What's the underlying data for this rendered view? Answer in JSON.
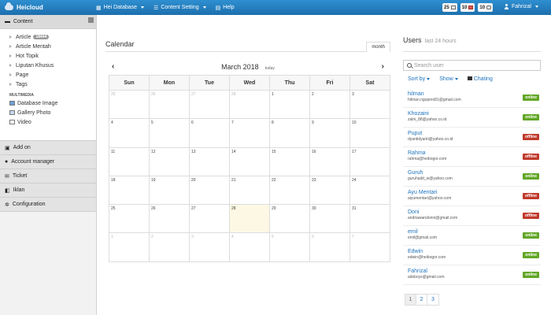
{
  "app": {
    "brand": "Heicloud"
  },
  "topnav": [
    {
      "label": "Hei Database",
      "icon": "grid-icon"
    },
    {
      "label": "Content Setting",
      "icon": "list-icon"
    },
    {
      "label": "Help",
      "icon": "help-icon"
    }
  ],
  "badges": [
    {
      "count": "25",
      "icon": "keyboard-icon"
    },
    {
      "count": "10",
      "icon": "calendar-icon"
    },
    {
      "count": "10",
      "icon": "chat-icon"
    }
  ],
  "user_menu": {
    "name": "Fahrizal"
  },
  "sidebar": {
    "content_title": "Content",
    "items": [
      {
        "label": "Article",
        "count": "18444"
      },
      {
        "label": "Article Mentah"
      },
      {
        "label": "Hot Topik"
      },
      {
        "label": "Liputan Khusus"
      },
      {
        "label": "Page"
      },
      {
        "label": "Tags"
      }
    ],
    "multimedia_title": "MULTIMEDIA",
    "media": [
      {
        "label": "Database Image"
      },
      {
        "label": "Gallery Photo"
      },
      {
        "label": "Video"
      }
    ],
    "sections": [
      {
        "label": "Add on"
      },
      {
        "label": "Account manager"
      },
      {
        "label": "Ticket"
      },
      {
        "label": "Iklan"
      },
      {
        "label": "Configuration"
      }
    ]
  },
  "calendar": {
    "title": "Calendar",
    "tab": "month",
    "month_label": "March 2018",
    "today_label": "today",
    "prev": "‹",
    "next": "›",
    "days": [
      "Sun",
      "Mon",
      "Tue",
      "Wed",
      "Thu",
      "Fri",
      "Sat"
    ],
    "weeks": [
      [
        "25",
        "26",
        "27",
        "28",
        "1",
        "2",
        "3"
      ],
      [
        "4",
        "5",
        "6",
        "7",
        "8",
        "9",
        "10"
      ],
      [
        "11",
        "12",
        "13",
        "14",
        "15",
        "16",
        "17"
      ],
      [
        "18",
        "19",
        "20",
        "21",
        "22",
        "23",
        "24"
      ],
      [
        "25",
        "26",
        "27",
        "28",
        "29",
        "30",
        "31"
      ],
      [
        "1",
        "2",
        "3",
        "4",
        "5",
        "6",
        "7"
      ]
    ]
  },
  "users_panel": {
    "title": "Users",
    "subtitle": "last 24 hours",
    "search_placeholder": "Search user",
    "sort_label": "Sort by",
    "show_label": "Show",
    "chat_label": "Chating",
    "users": [
      {
        "name": "hilman",
        "email": "hilman.ngoprex81@gmail.com",
        "status": "online"
      },
      {
        "name": "Khozaini",
        "email": "zaini_88@yahoo.co.id",
        "status": "online"
      },
      {
        "name": "Puput",
        "email": "dyantidyanti@yahoo.co.id",
        "status": "offline"
      },
      {
        "name": "Rahma",
        "email": "rahma@heibogor.com",
        "status": "offline"
      },
      {
        "name": "Guruh",
        "email": "guruhadit_w@yahoo.com",
        "status": "online"
      },
      {
        "name": "Ayu Mentari",
        "email": "aiyumentari@yahoo.com",
        "status": "offline"
      },
      {
        "name": "Doni",
        "email": "andriawandonni@gmail.com",
        "status": "offline"
      },
      {
        "name": "emil",
        "email": "emil@gmail.com",
        "status": "online"
      },
      {
        "name": "Edwin",
        "email": "edwin@heibogor.com",
        "status": "online"
      },
      {
        "name": "Fahrizal",
        "email": "adsboys@gmail.com",
        "status": "online"
      }
    ],
    "pages": [
      "1",
      "2",
      "3"
    ]
  }
}
